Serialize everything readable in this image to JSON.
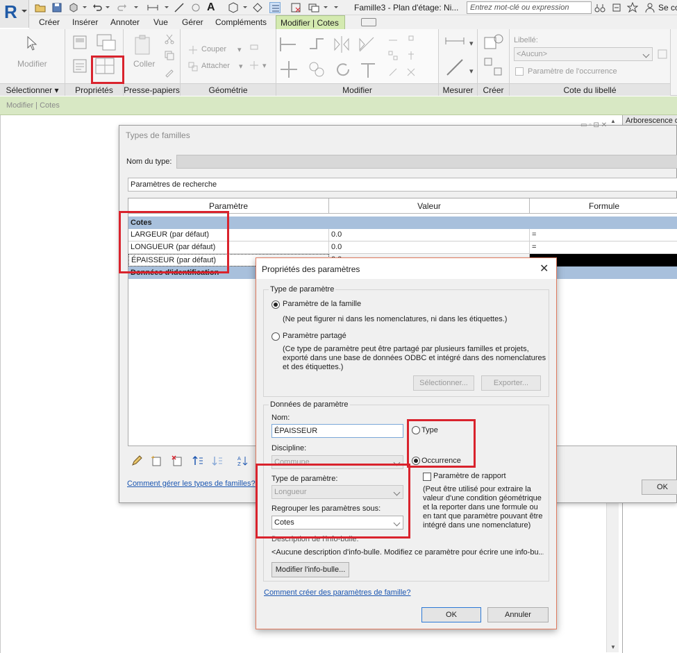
{
  "app": {
    "logo_letter": "R",
    "doc_title": "Famille3 - Plan d'étage: Ni...",
    "search_placeholder": "Entrez mot-clé ou expression",
    "signin": "Se co"
  },
  "ribbon_tabs": [
    "Créer",
    "Insérer",
    "Annoter",
    "Vue",
    "Gérer",
    "Compléments"
  ],
  "ribbon_active_tab": "Modifier | Cotes",
  "ribbon": {
    "modify_label": "Modifier",
    "panels": {
      "select": "Sélectionner",
      "properties": "Propriétés",
      "clipboard": "Presse-papiers",
      "geometry": "Géométrie",
      "modify": "Modifier",
      "measure": "Mesurer",
      "create": "Créer",
      "label_dim": "Cote du libellé"
    },
    "paste_label": "Coller",
    "cut_label": "Couper",
    "join_label": "Attacher",
    "label_field_caption": "Libellé:",
    "label_value": "<Aucun>",
    "instance_param_label": "Paramètre de l'occurrence"
  },
  "context_bar": "Modifier | Cotes",
  "project_browser_title": "Arborescence d",
  "family_types": {
    "title": "Types de familles",
    "type_name_label": "Nom du type:",
    "search_params": "Paramètres de recherche",
    "columns": [
      "Paramètre",
      "Valeur",
      "Formule"
    ],
    "groups": [
      {
        "name": "Cotes",
        "rows": [
          {
            "param": "LARGEUR (par défaut)",
            "value": "0.0",
            "formula": "="
          },
          {
            "param": "LONGUEUR (par défaut)",
            "value": "0.0",
            "formula": "="
          },
          {
            "param": "ÉPAISSEUR (par défaut)",
            "value": "0.0",
            "formula": ""
          }
        ]
      },
      {
        "name": "Données d'identification",
        "rows": []
      }
    ],
    "help_link": "Comment gérer les types de familles?",
    "ok": "OK"
  },
  "param_props": {
    "title": "Propriétés des paramètres",
    "close_glyph": "✕",
    "param_type_group": "Type de paramètre",
    "family_param": "Paramètre de la famille",
    "family_param_note": "(Ne peut figurer ni dans les nomenclatures, ni dans les étiquettes.)",
    "shared_param": "Paramètre partagé",
    "shared_param_note_1": "(Ce type de paramètre peut être partagé par plusieurs familles et projets,",
    "shared_param_note_2": "exporté dans une base de données ODBC et intégré dans des nomenclatures",
    "shared_param_note_3": "et des étiquettes.)",
    "select_btn": "Sélectionner...",
    "export_btn": "Exporter...",
    "param_data_group": "Données de paramètre",
    "name_label": "Nom:",
    "name_value": "ÉPAISSEUR",
    "type_radio": "Type",
    "occurrence_radio": "Occurrence",
    "discipline_label": "Discipline:",
    "discipline_value": "Commune",
    "report_param": "Paramètre de rapport",
    "report_note_1": "(Peut être utilisé pour extraire la",
    "report_note_2": "valeur d'une condition géométrique",
    "report_note_3": "et la reporter dans une formule ou",
    "report_note_4": "en tant que paramètre pouvant être",
    "report_note_5": "intégré dans une nomenclature)",
    "param_type_label": "Type de paramètre:",
    "param_type_value": "Longueur",
    "group_under_label": "Regrouper les paramètres sous:",
    "group_under_value": "Cotes",
    "tooltip_label": "Description de l'info-bulle:",
    "tooltip_value": "<Aucune description d'info-bulle. Modifiez ce paramètre pour écrire une info-bu...",
    "edit_tooltip_btn": "Modifier l'info-bulle...",
    "help_link": "Comment créer des paramètres de famille?",
    "ok": "OK",
    "cancel": "Annuler"
  },
  "colors": {
    "highlight": "#d9232d",
    "active_tab": "#d4eab0",
    "group_row": "#a8c0dc"
  }
}
